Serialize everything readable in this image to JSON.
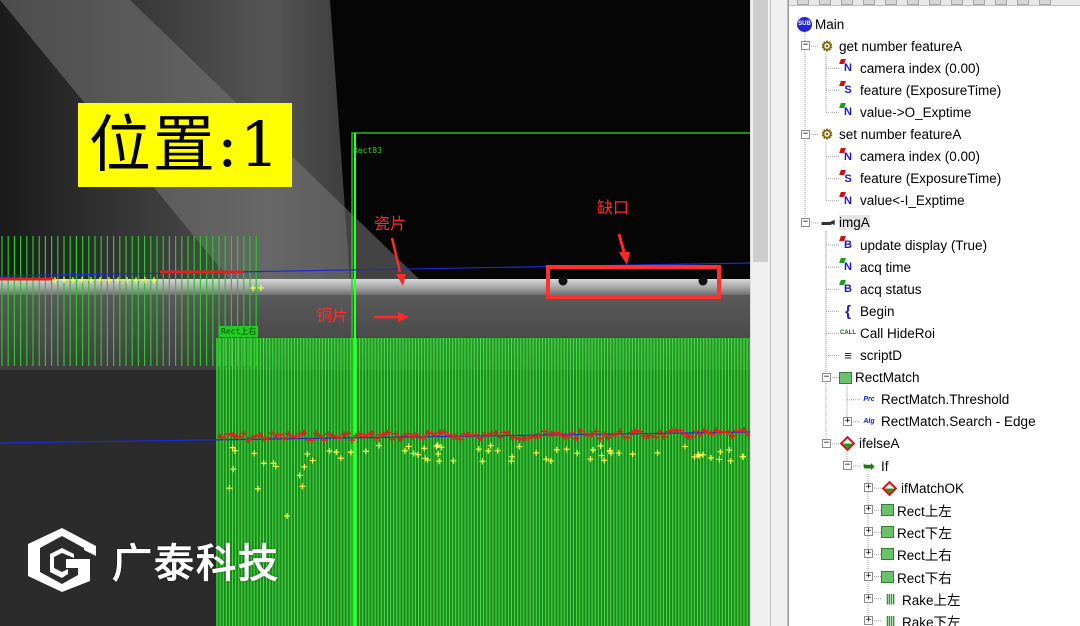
{
  "viewer": {
    "position_label": "位置:1",
    "annotations": {
      "ceramic": "瓷片",
      "copper": "铜片",
      "notch": "缺口"
    },
    "roi_main": "Rect83",
    "roi_sub": "Rect上右",
    "brand": "广泰科技",
    "colors": {
      "overlay_green": "#22cc22",
      "annotation_red": "#ff2a2a",
      "label_yellow": "#ffff00",
      "edge_point_red": "#e02020",
      "edge_point_yellow": "#ffff55",
      "baseline_blue": "#1e2ad0"
    }
  },
  "tree": {
    "nodes": [
      {
        "label": "Main",
        "icon": "sub-icon",
        "level": 0,
        "expander": "none"
      },
      {
        "label": "get number featureA",
        "icon": "feature-get-icon",
        "level": 1,
        "expander": "minus"
      },
      {
        "label": "camera index (0.00)",
        "icon": "number-param-icon",
        "level": 2,
        "expander": "none"
      },
      {
        "label": "feature (ExposureTime)",
        "icon": "string-param-icon",
        "level": 2,
        "expander": "none"
      },
      {
        "label": "value->O_Exptime",
        "icon": "number-output-icon",
        "level": 2,
        "expander": "none"
      },
      {
        "label": "set number featureA",
        "icon": "feature-set-icon",
        "level": 1,
        "expander": "minus"
      },
      {
        "label": "camera index (0.00)",
        "icon": "number-param-icon",
        "level": 2,
        "expander": "none"
      },
      {
        "label": "feature (ExposureTime)",
        "icon": "string-param-icon",
        "level": 2,
        "expander": "none"
      },
      {
        "label": "value<-I_Exptime",
        "icon": "number-input-icon",
        "level": 2,
        "expander": "none"
      },
      {
        "label": "imgA",
        "icon": "camera-icon",
        "level": 1,
        "expander": "minus",
        "selected": true
      },
      {
        "label": "update display (True)",
        "icon": "bool-param-icon",
        "level": 2,
        "expander": "none"
      },
      {
        "label": "acq time",
        "icon": "number-output-icon",
        "level": 2,
        "expander": "none"
      },
      {
        "label": "acq status",
        "icon": "bool-output-icon",
        "level": 2,
        "expander": "none"
      },
      {
        "label": "Begin",
        "icon": "brace-icon",
        "level": 2,
        "expander": "none"
      },
      {
        "label": "Call HideRoi",
        "icon": "call-icon",
        "level": 2,
        "expander": "none"
      },
      {
        "label": "scriptD",
        "icon": "script-icon",
        "level": 2,
        "expander": "none"
      },
      {
        "label": "RectMatch",
        "icon": "rect-tool-icon",
        "level": 2,
        "expander": "minus"
      },
      {
        "label": "RectMatch.Threshold",
        "icon": "process-icon",
        "level": 3,
        "expander": "none"
      },
      {
        "label": "RectMatch.Search - Edge",
        "icon": "algorithm-icon",
        "level": 3,
        "expander": "plus"
      },
      {
        "label": "ifelseA",
        "icon": "diamond-icon",
        "level": 2,
        "expander": "minus"
      },
      {
        "label": "If",
        "icon": "if-branch-icon",
        "level": 3,
        "expander": "minus"
      },
      {
        "label": "ifMatchOK",
        "icon": "diamond-icon",
        "level": 4,
        "expander": "plus"
      },
      {
        "label": "Rect上左",
        "icon": "rect-tool-icon",
        "level": 4,
        "expander": "plus"
      },
      {
        "label": "Rect下左",
        "icon": "rect-tool-icon",
        "level": 4,
        "expander": "plus"
      },
      {
        "label": "Rect上右",
        "icon": "rect-tool-icon",
        "level": 4,
        "expander": "plus"
      },
      {
        "label": "Rect下右",
        "icon": "rect-tool-icon",
        "level": 4,
        "expander": "plus"
      },
      {
        "label": "Rake上左",
        "icon": "rake-tool-icon",
        "level": 4,
        "expander": "plus"
      },
      {
        "label": "Rake下左",
        "icon": "rake-tool-icon",
        "level": 4,
        "expander": "plus"
      }
    ]
  }
}
